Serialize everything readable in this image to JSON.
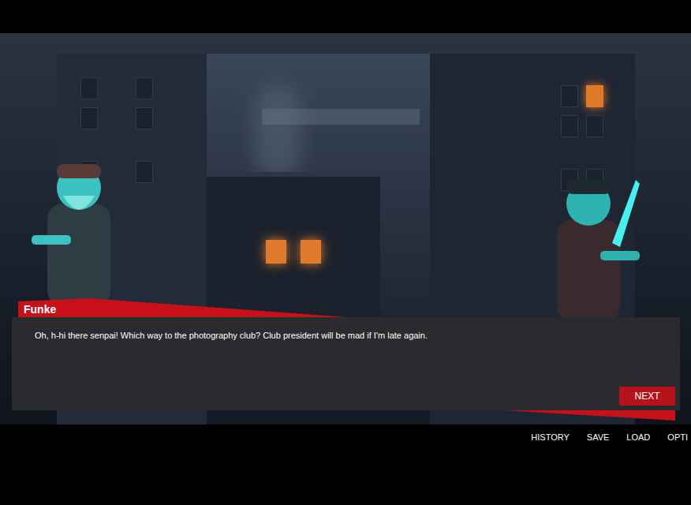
{
  "scene": {
    "name_tag": "Funke",
    "dialogue": "Oh, h-hi there senpai! Which way to the photography club? Club president will be mad if I'm late again.",
    "next_button": "NEXT"
  },
  "menu": [
    {
      "label": "HISTORY"
    },
    {
      "label": "SAVE"
    },
    {
      "label": "LOAD"
    },
    {
      "label": "OPTI"
    }
  ]
}
